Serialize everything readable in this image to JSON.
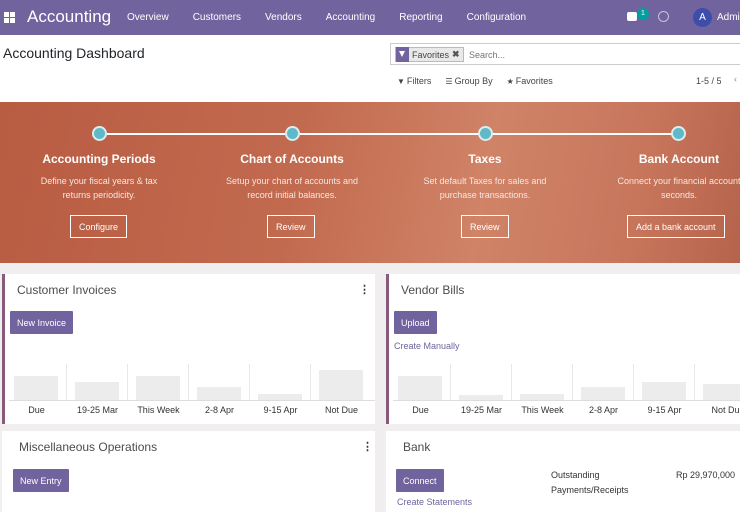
{
  "app": {
    "brand": "Accounting",
    "menu": [
      "Overview",
      "Customers",
      "Vendors",
      "Accounting",
      "Reporting",
      "Configuration"
    ],
    "chat_count": "1",
    "user_initial": "A",
    "user_name": "Admi"
  },
  "control": {
    "page_title": "Accounting Dashboard",
    "facet_label": "Favorites",
    "facet_remove": "✖",
    "search_placeholder": "Search...",
    "filters_label": "Filters",
    "group_by_label": "Group By",
    "favorites_label": "Favorites",
    "pager": "1-5 / 5"
  },
  "banner": {
    "steps": [
      {
        "title": "Accounting Periods",
        "desc": [
          "Define your fiscal years & tax",
          "returns periodicity."
        ],
        "button": "Configure"
      },
      {
        "title": "Chart of Accounts",
        "desc": [
          "Setup your chart of accounts and",
          "record initial balances."
        ],
        "button": "Review"
      },
      {
        "title": "Taxes",
        "desc": [
          "Set default Taxes for sales and",
          "purchase transactions."
        ],
        "button": "Review"
      },
      {
        "title": "Bank Account",
        "desc": [
          "Connect your financial account",
          "seconds."
        ],
        "button": "Add a bank account"
      }
    ]
  },
  "cards": {
    "customer_invoices": {
      "title": "Customer Invoices",
      "button": "New Invoice",
      "menu_glyph": "⋮"
    },
    "vendor_bills": {
      "title": "Vendor Bills",
      "button": "Upload",
      "link": "Create Manually",
      "menu_glyph": "⋮"
    },
    "misc": {
      "title": "Miscellaneous Operations",
      "button": "New Entry",
      "menu_glyph": "⋮"
    },
    "bank": {
      "title": "Bank",
      "button": "Connect",
      "link": "Create Statements",
      "label_line1": "Outstanding",
      "label_line2": "Payments/Receipts",
      "amount": "Rp 29,970,000"
    }
  },
  "chart_data": [
    {
      "type": "bar",
      "categories": [
        "Due",
        "19-25 Mar",
        "This Week",
        "2-8 Apr",
        "9-15 Apr",
        "Not Due"
      ],
      "values": [
        0.75,
        0.55,
        0.75,
        0.4,
        0.2,
        0.95
      ]
    },
    {
      "type": "bar",
      "categories": [
        "Due",
        "19-25 Mar",
        "This Week",
        "2-8 Apr",
        "9-15 Apr",
        "Not Du"
      ],
      "values": [
        0.75,
        0.15,
        0.2,
        0.4,
        0.55,
        0.5
      ]
    }
  ]
}
